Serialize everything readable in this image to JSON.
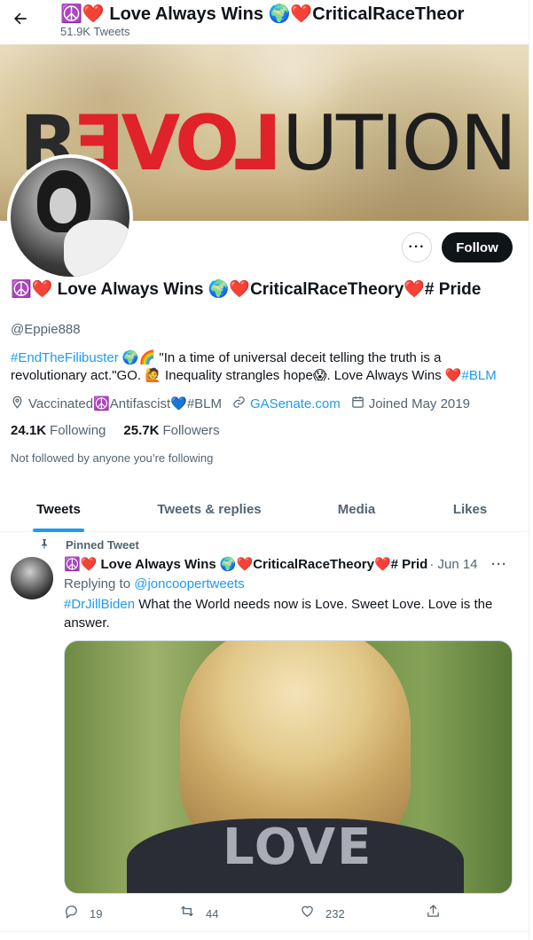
{
  "header": {
    "title": "☮️❤️ Love Always Wins 🌍❤️CriticalRaceTheor",
    "tweet_count": "51.9K Tweets"
  },
  "banner": {
    "word_r": "R",
    "word_love": "LOVE",
    "word_ution": "UTION"
  },
  "profile": {
    "display_name": "☮️❤️ Love Always Wins 🌍❤️CriticalRaceTheory❤️# Pride",
    "handle": "@Eppie888",
    "bio_hashtag": "#EndTheFilibuster",
    "bio_text": " 🌍🌈 \"In a time of universal deceit telling the truth is a revolutionary act.\"GO. 🙋 Inequality strangles hope😱. Love Always Wins ❤️",
    "bio_hashtag2": "#BLM",
    "location": "Vaccinated☮️Antifascist💙#BLM",
    "website": "GASenate.com",
    "joined": "Joined May 2019",
    "following_count": "24.1K",
    "following_label": "Following",
    "followers_count": "25.7K",
    "followers_label": "Followers",
    "not_followed": "Not followed by anyone you’re following"
  },
  "buttons": {
    "more": "···",
    "follow": "Follow"
  },
  "tabs": [
    {
      "label": "Tweets",
      "active": true
    },
    {
      "label": "Tweets & replies",
      "active": false
    },
    {
      "label": "Media",
      "active": false
    },
    {
      "label": "Likes",
      "active": false
    }
  ],
  "tweet": {
    "pinned_label": "Pinned Tweet",
    "author": "☮️❤️ Love Always Wins 🌍❤️CriticalRaceTheory❤️# Prid",
    "date": "· Jun 14",
    "more": "···",
    "replying_prefix": "Replying to",
    "replying_handle": "@joncoopertweets",
    "hashtag": "#DrJillBiden",
    "text": " What the World needs now is Love. Sweet Love. Love is the answer.",
    "media_word": "LOVE",
    "replies": "19",
    "retweets": "44",
    "likes": "232"
  },
  "icons": {
    "back": "back-arrow-icon",
    "location": "location-pin-icon",
    "link": "link-icon",
    "calendar": "calendar-icon",
    "pin": "pin-icon",
    "reply": "reply-icon",
    "retweet": "retweet-icon",
    "like": "heart-icon",
    "share": "share-icon"
  },
  "colors": {
    "accent": "#1d9bf0",
    "text": "#0f1419",
    "muted": "#536471",
    "follow_bg": "#0f1419"
  }
}
